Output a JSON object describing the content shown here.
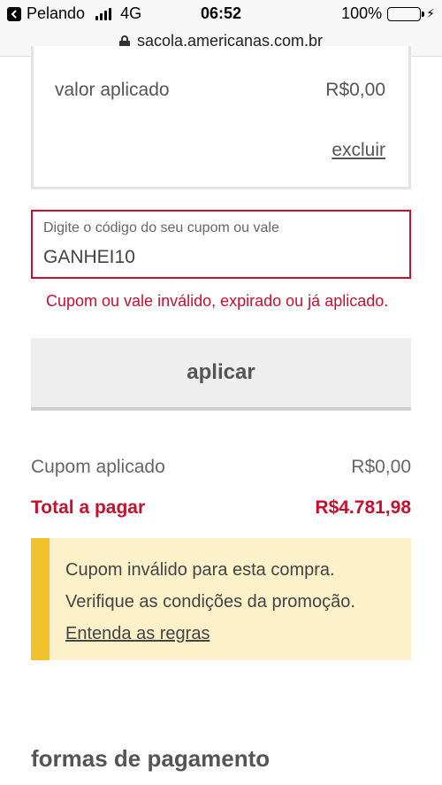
{
  "status_bar": {
    "carrier": "Pelando",
    "network": "4G",
    "time": "06:52",
    "battery": "100%",
    "back_icon": "chevron-left-icon"
  },
  "url_bar": {
    "url": "sacola.americanas.com.br",
    "icon": "lock-icon"
  },
  "coupon_card": {
    "valor_label": "valor aplicado",
    "valor_value": "R$0,00",
    "remove_label": "excluir"
  },
  "coupon_input": {
    "label": "Digite o código do seu cupom ou vale",
    "value": "GANHEI10"
  },
  "error_message": "Cupom ou vale inválido, expirado ou já aplicado.",
  "apply_button": "aplicar",
  "summary": {
    "coupon_label": "Cupom aplicado",
    "coupon_value": "R$0,00",
    "total_label": "Total a pagar",
    "total_value": "R$4.781,98"
  },
  "notice": {
    "line1": "Cupom inválido para esta compra.",
    "line2": "Verifique as condições da promoção.",
    "link": "Entenda as regras"
  },
  "payment_section_title": "formas de pagamento",
  "colors": {
    "error_red": "#c8102e",
    "notice_bg": "#fcf1c9",
    "notice_accent": "#f2c12e",
    "battery_green": "#4cd964"
  }
}
